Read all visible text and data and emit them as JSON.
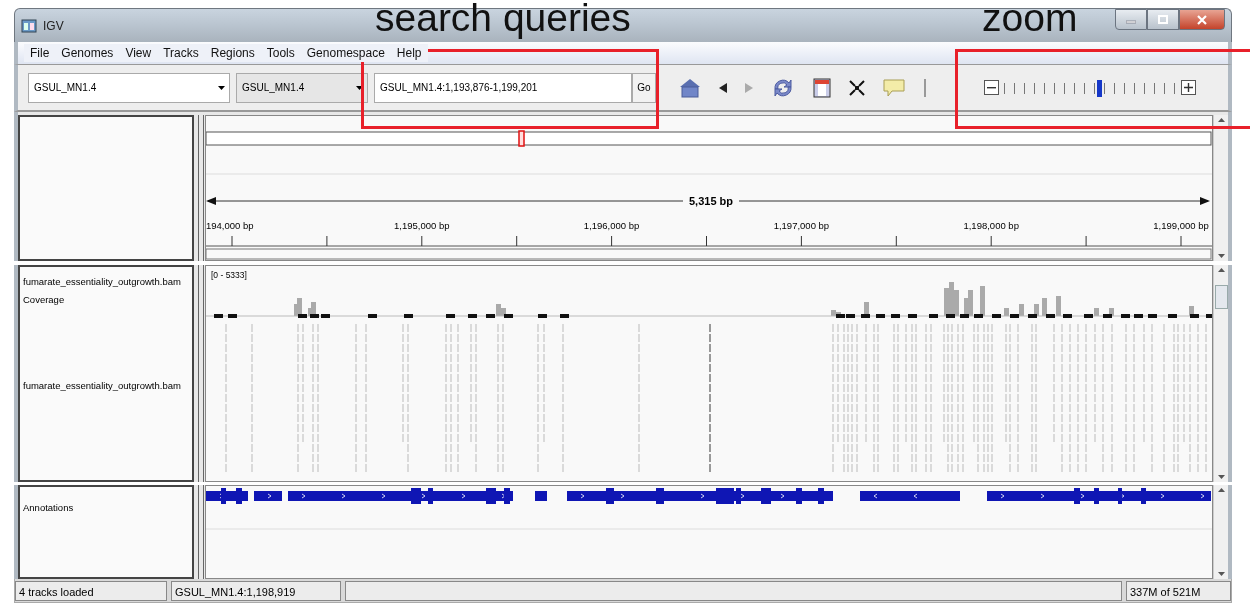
{
  "window": {
    "title": "IGV"
  },
  "callouts": [
    {
      "label": "search queries"
    },
    {
      "label": "zoom"
    }
  ],
  "menu": [
    "File",
    "Genomes",
    "View",
    "Tracks",
    "Regions",
    "Tools",
    "Genomespace",
    "Help"
  ],
  "toolbar": {
    "genome": "GSUL_MN1.4",
    "chromosome": "GSUL_MN1.4",
    "locus": "GSUL_MN1.4:1,193,876-1,199,201",
    "go": "Go",
    "nav": [
      {
        "kind": "back",
        "disabled": false
      },
      {
        "kind": "forward",
        "disabled": true
      }
    ],
    "zoom": {
      "level": 0.56
    }
  },
  "ruler": {
    "span": "5,315 bp",
    "ticks": [
      "194,000 bp",
      "1,195,000 bp",
      "1,196,000 bp",
      "1,197,000 bp",
      "1,198,000 bp",
      "1,199,000 bp"
    ]
  },
  "tracks": [
    {
      "name": "fumarate_essentiality_outgrowth.bam Coverage",
      "kind": "coverage",
      "range": "[0 - 5333]"
    },
    {
      "name": "fumarate_essentiality_outgrowth.bam",
      "kind": "alignments"
    },
    {
      "name": "Annotations",
      "kind": "genes"
    }
  ],
  "status_bar": {
    "message": "4 tracks loaded",
    "position": "GSUL_MN1.4:1,198,919",
    "memory": "337M of 521M"
  }
}
